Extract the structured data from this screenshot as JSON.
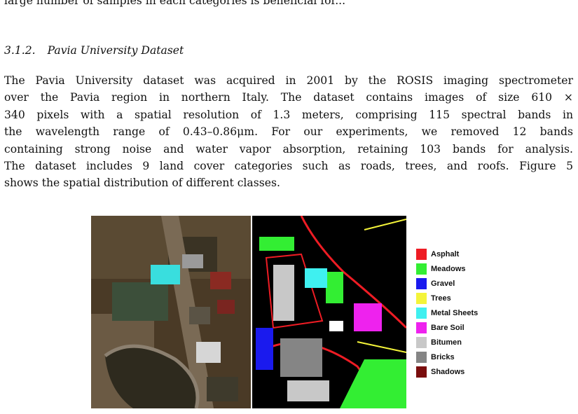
{
  "top_fragment": "large number of samples in each categories is beneficial for...",
  "section": {
    "number": "3.1.2.",
    "title": "Pavia University Dataset"
  },
  "paragraph_lines": [
    "The Pavia University dataset was acquired in 2001 by the ROSIS imaging spectrometer",
    "over the Pavia region in northern Italy. The dataset contains images of size 610 ×",
    "340 pixels with a spatial resolution of 1.3 meters, comprising 115 spectral bands in",
    "the wavelength range of 0.43–0.86μm. For our experiments, we removed 12 bands",
    "containing strong noise and water vapor absorption, retaining 103 bands for analysis.",
    "The dataset includes 9 land cover categories such as roads, trees, and roofs. Figure 5",
    "shows the spatial distribution of different classes."
  ],
  "legend": [
    {
      "label": "Asphalt",
      "color": "#ee1c24"
    },
    {
      "label": "Meadows",
      "color": "#33ee33"
    },
    {
      "label": "Gravel",
      "color": "#1a1aee"
    },
    {
      "label": "Trees",
      "color": "#f4f43a"
    },
    {
      "label": "Metal Sheets",
      "color": "#3ff0f0"
    },
    {
      "label": "Bare Soil",
      "color": "#ee22ee"
    },
    {
      "label": "Bitumen",
      "color": "#c8c8c8"
    },
    {
      "label": "Bricks",
      "color": "#858585"
    },
    {
      "label": "Shadows",
      "color": "#7a0d0d"
    }
  ]
}
